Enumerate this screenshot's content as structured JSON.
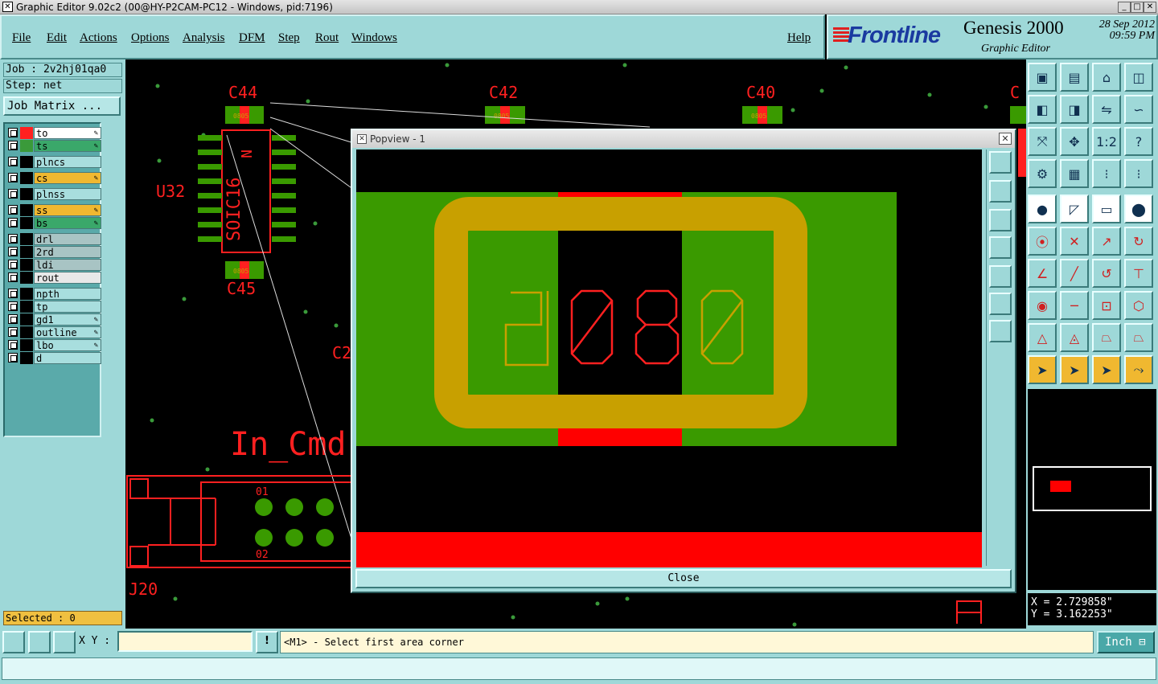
{
  "window": {
    "title": "Graphic Editor 9.02c2 (00@HY-P2CAM-PC12 - Windows, pid:7196)",
    "min": "_",
    "max": "□",
    "close": "✕"
  },
  "menu": {
    "file": "File",
    "edit": "Edit",
    "actions": "Actions",
    "options": "Options",
    "analysis": "Analysis",
    "dfm": "DFM",
    "step": "Step",
    "rout": "Rout",
    "windows": "Windows",
    "help": "Help"
  },
  "brand": {
    "logo": "Frontline",
    "product": "Genesis 2000",
    "subtitle": "Graphic Editor",
    "date": "28 Sep 2012",
    "time": "09:59 PM"
  },
  "left": {
    "job": "Job : 2v2hj01qa0",
    "step": "Step: net",
    "job_matrix": "Job Matrix ...",
    "layers": [
      {
        "name": "to",
        "bg": "#ffffff",
        "color": "#ff2020",
        "mark": "✎"
      },
      {
        "name": "ts",
        "bg": "#3aa86a",
        "color": "#3a9a3a",
        "mark": "✎"
      },
      {
        "name": "plncs",
        "bg": "#a8dede",
        "color": "#000000",
        "mark": ""
      },
      {
        "name": "cs",
        "bg": "#f0b830",
        "color": "#000000",
        "mark": "✎"
      },
      {
        "name": "plnss",
        "bg": "#a8dede",
        "color": "#000000",
        "mark": ""
      },
      {
        "name": "ss",
        "bg": "#f0b830",
        "color": "#000000",
        "mark": "✎"
      },
      {
        "name": "bs",
        "bg": "#3aa86a",
        "color": "#000000",
        "mark": "✎"
      },
      {
        "name": "drl",
        "bg": "#a8c4c4",
        "color": "#000000",
        "mark": ""
      },
      {
        "name": "2rd",
        "bg": "#a8c4c4",
        "color": "#000000",
        "mark": ""
      },
      {
        "name": "ldi",
        "bg": "#a8c4c4",
        "color": "#000000",
        "mark": ""
      },
      {
        "name": "rout",
        "bg": "#e8e8e8",
        "color": "#000000",
        "mark": ""
      },
      {
        "name": "npth",
        "bg": "#a8dede",
        "color": "#000000",
        "mark": ""
      },
      {
        "name": "tp",
        "bg": "#a8dede",
        "color": "#000000",
        "mark": ""
      },
      {
        "name": "gd1",
        "bg": "#a8dede",
        "color": "#000000",
        "mark": "✎"
      },
      {
        "name": "outline",
        "bg": "#a8dede",
        "color": "#000000",
        "mark": "✎"
      },
      {
        "name": "lbo",
        "bg": "#a8dede",
        "color": "#000000",
        "mark": "✎"
      },
      {
        "name": "d",
        "bg": "#a8dede",
        "color": "#000000",
        "mark": ""
      }
    ],
    "selected": "Selected : 0"
  },
  "canvas": {
    "labels": {
      "c44": "C44",
      "c42": "C42",
      "c40": "C40",
      "c_partial": "C",
      "c45": "C45",
      "u32": "U32",
      "c2_partial": "C2",
      "in_cmd": "In_Cmd",
      "j20": "J20",
      "soic": "SOIC16",
      "pin1": "01",
      "pin2": "02",
      "n_label": "N"
    },
    "pad_text": "0805"
  },
  "popup": {
    "title": "Popview - 1",
    "close_x": "✕",
    "big_text": "0805",
    "close_label": "Close"
  },
  "right": {
    "x": "X = 2.729858\"",
    "y": "Y = 3.162253\""
  },
  "bottom": {
    "xy_label": "X Y :",
    "xy_value": "",
    "message": "<M1> - Select first area corner",
    "unit": "Inch ⊟"
  },
  "colors": {
    "accent": "#9ed8d8",
    "copper_red": "#ff0000",
    "solder_green": "#3a9a00",
    "silk_yellow": "#c8a000"
  }
}
